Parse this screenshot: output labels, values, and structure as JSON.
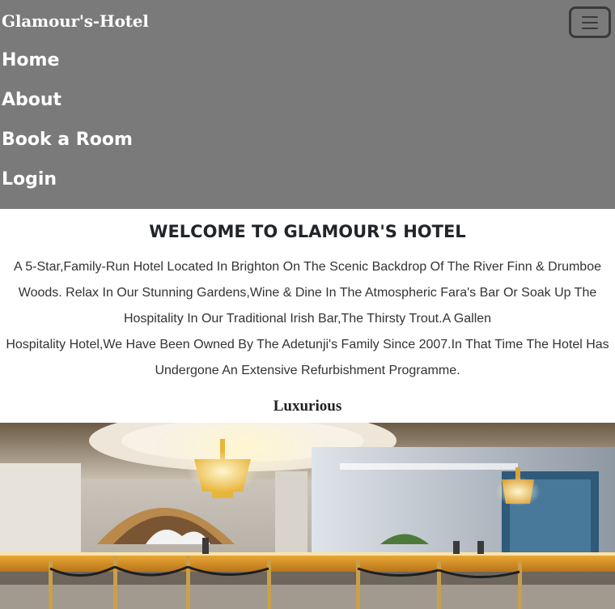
{
  "navbar": {
    "brand": "Glamour's-Hotel",
    "toggler_icon": "hamburger-menu-icon",
    "links": [
      {
        "label": "Home"
      },
      {
        "label": "About"
      },
      {
        "label": "Book a Room"
      },
      {
        "label": "Login"
      }
    ]
  },
  "main": {
    "title": "WELCOME TO GLAMOUR'S HOTEL",
    "intro_line1": "A 5-Star,Family-Run Hotel Located In Brighton On The Scenic Backdrop Of The River Finn & Drumboe Woods. Relax In Our Stunning Gardens,Wine & Dine In The Atmospheric Fara's Bar Or Soak Up The Hospitality In Our Traditional Irish Bar,The Thirsty Trout.A Gallen",
    "intro_line2": "Hospitality Hotel,We Have Been Owned By The Adetunji's Family Since 2007.In That Time The Hotel Has Undergone An Extensive Refurbishment Programme.",
    "section_heading": "Luxurious"
  },
  "colors": {
    "navbar_bg": "#7a7a7a",
    "nav_text": "#ffffff",
    "body_text": "#333333"
  }
}
